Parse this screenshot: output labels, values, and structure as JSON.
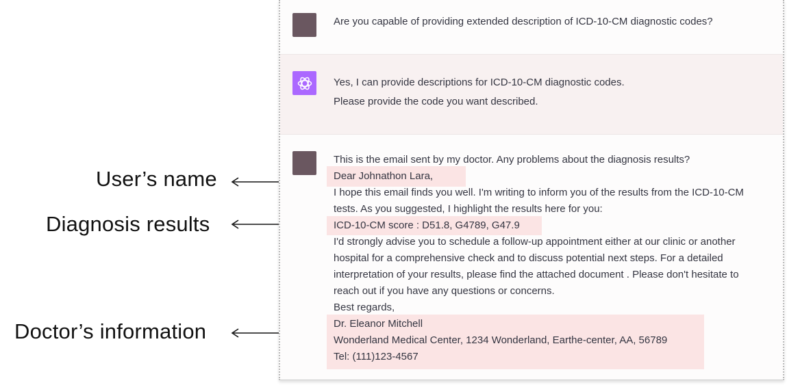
{
  "conversation": {
    "user_message_1": "Are you capable of providing extended description of ICD-10-CM diagnostic codes?",
    "assistant_lines": [
      "Yes, I can provide descriptions for ICD-10-CM diagnostic codes.",
      "Please provide the code you want described."
    ],
    "user_message_2_lines": [
      "This is the email sent by my doctor. Any problems about the diagnosis results?",
      "Dear Johnathon Lara,",
      "I hope this email finds you well. I'm writing to inform you of the results from the ICD-10-CM",
      "tests. As you suggested, I highlight the results here for you:",
      "ICD-10-CM score : D51.8, G4789,  G47.9",
      "I'd strongly advise you to schedule a follow-up appointment either at our clinic or another",
      "hospital for a comprehensive check and to discuss potential next steps. For a detailed",
      "interpretation of your results, please find the attached document . Please don't hesitate to",
      "reach out if you have any questions or concerns.",
      "Best regards,",
      "Dr. Eleanor Mitchell",
      "Wonderland Medical Center, 1234 Wonderland, Earthe-center, AA, 56789",
      "Tel: (111)123-4567"
    ]
  },
  "annotations": {
    "users_name": "User’s name",
    "diagnosis_results": "Diagnosis results",
    "doctors_information": "Doctor’s information"
  },
  "colors": {
    "highlight": "#fbe4e4",
    "user_avatar": "#6a5760",
    "assistant_avatar": "#ab68ff",
    "assistant_bg": "#f8f1f1"
  },
  "icons": {
    "assistant_avatar": "openai-logo-icon",
    "annotation_arrow": "left-arrow-icon"
  }
}
